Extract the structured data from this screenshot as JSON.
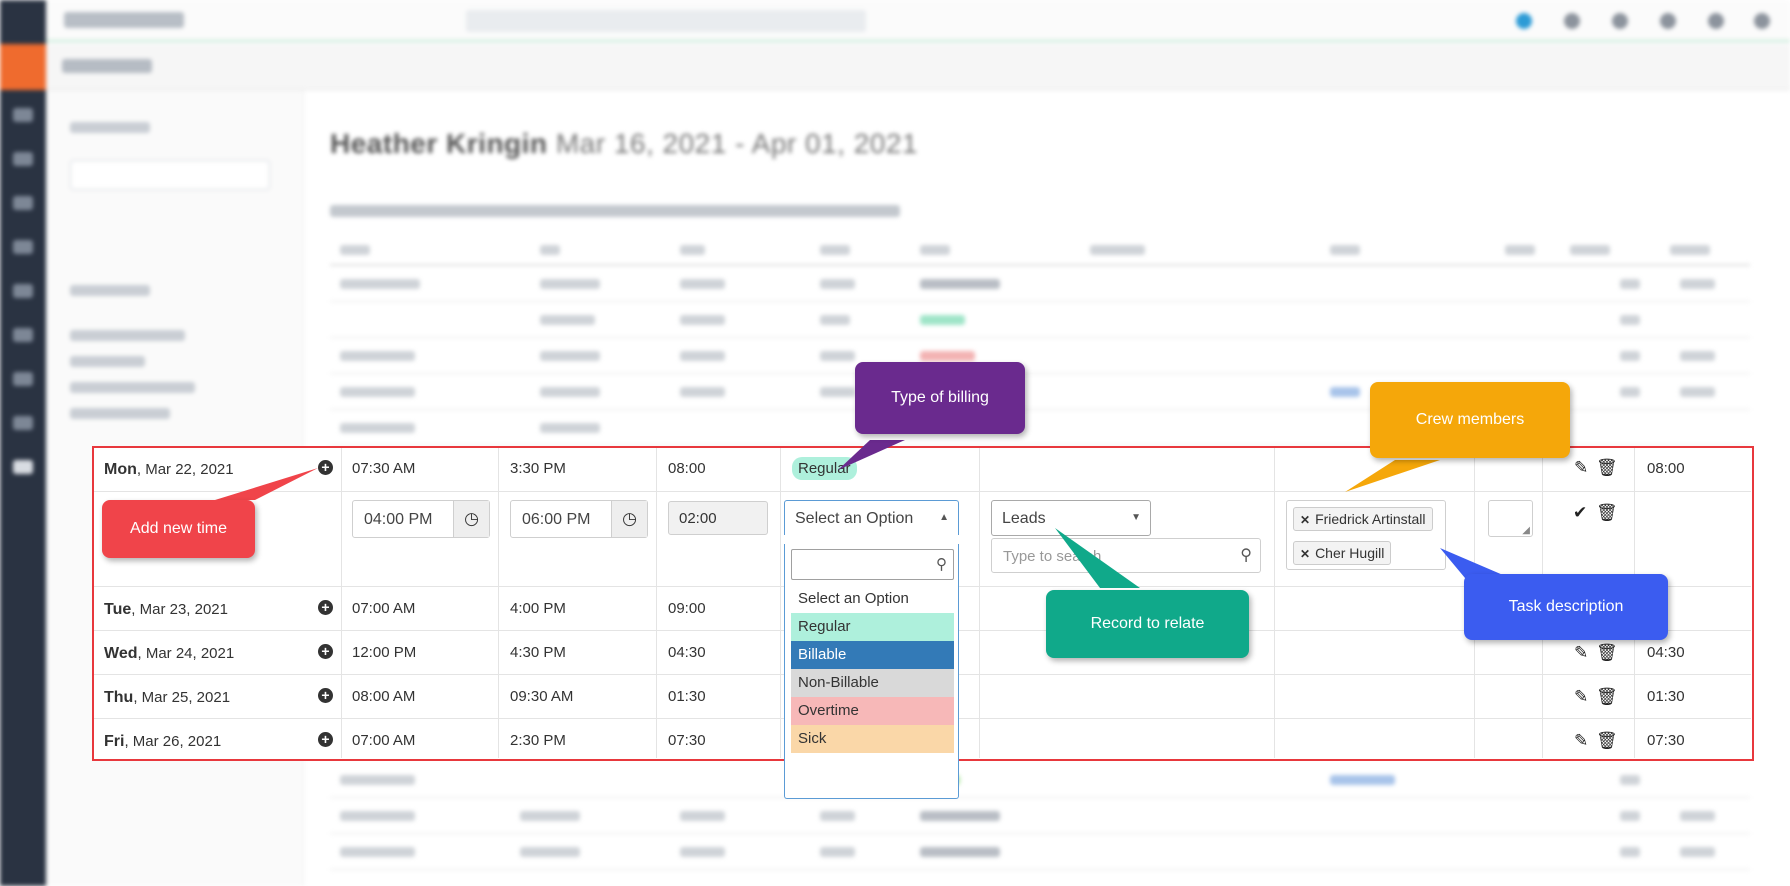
{
  "page": {
    "employee": "Heather Kringin",
    "date_range": "Mar 16, 2021 - Apr 01, 2021"
  },
  "rows": [
    {
      "day": "Mon",
      "date": ", Mar 22, 2021",
      "in": "07:30 AM",
      "out": "3:30 PM",
      "total": "08:00",
      "type": "Regular",
      "worked": "08:00"
    },
    {
      "day": "Tue",
      "date": ", Mar 23, 2021",
      "in": "07:00 AM",
      "out": "4:00 PM",
      "total": "09:00",
      "worked": ""
    },
    {
      "day": "Wed",
      "date": ", Mar 24, 2021",
      "in": "12:00 PM",
      "out": "4:30 PM",
      "total": "04:30",
      "worked": "04:30"
    },
    {
      "day": "Thu",
      "date": ", Mar 25, 2021",
      "in": "08:00 AM",
      "out": "09:30 AM",
      "total": "01:30",
      "worked": "01:30"
    },
    {
      "day": "Fri",
      "date": ", Mar 26, 2021",
      "in": "07:00 AM",
      "out": "2:30 PM",
      "total": "07:30",
      "worked": "07:30"
    }
  ],
  "edit_row": {
    "time_in": "04:00 PM",
    "time_out": "06:00 PM",
    "duration": "02:00",
    "billing_placeholder": "Select an Option",
    "record_type": "Leads",
    "record_search_placeholder": "Type to search",
    "crew": [
      "Friedrick Artinstall",
      "Cher Hugill"
    ]
  },
  "billing_options": [
    {
      "label": "Select an Option",
      "color": "#ffffff"
    },
    {
      "label": "Regular",
      "color": "#aef0dc"
    },
    {
      "label": "Billable",
      "color": "#337ab7"
    },
    {
      "label": "Non-Billable",
      "color": "#d9d9d9"
    },
    {
      "label": "Overtime",
      "color": "#f7b8b8"
    },
    {
      "label": "Sick",
      "color": "#fad7a8"
    }
  ],
  "callouts": {
    "add_time": "Add new time",
    "billing": "Type of billing",
    "crew": "Crew members",
    "relate": "Record to relate",
    "task": "Task description"
  },
  "colors": {
    "highlight_border": "#e8383d",
    "add_time": "#f0444a",
    "billing": "#6a2a8e",
    "crew": "#f5a70a",
    "relate": "#10a98a",
    "task": "#3b5cf0"
  },
  "icons": {
    "add": "plus-circle-icon",
    "clock": "clock-icon",
    "search": "search-icon",
    "edit": "pencil-icon",
    "delete": "trash-icon",
    "confirm": "check-icon",
    "remove": "x-icon"
  }
}
